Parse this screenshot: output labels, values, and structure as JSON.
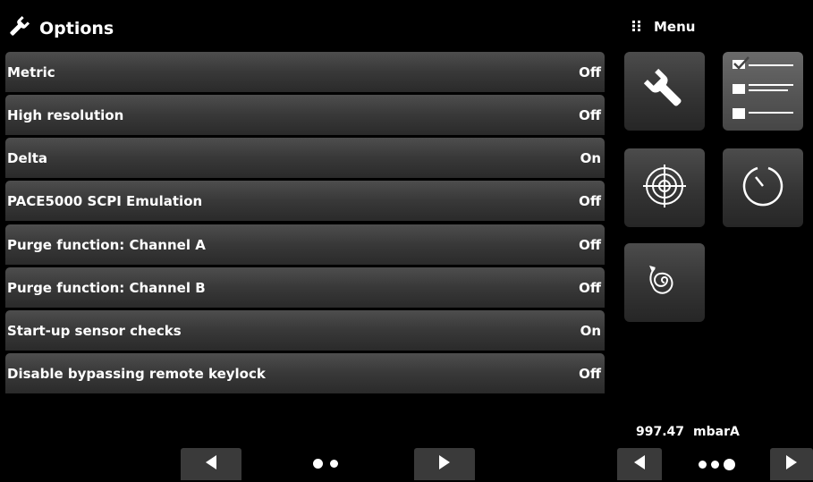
{
  "header": {
    "title": "Options",
    "icon": "wrench-icon"
  },
  "menu": {
    "label": "Menu",
    "icon": "grid-dots-icon"
  },
  "options": [
    {
      "label": "Metric",
      "value": "Off"
    },
    {
      "label": "High resolution",
      "value": "Off"
    },
    {
      "label": "Delta",
      "value": "On"
    },
    {
      "label": "PACE5000 SCPI Emulation",
      "value": "Off"
    },
    {
      "label": "Purge function: Channel A",
      "value": "Off"
    },
    {
      "label": "Purge function: Channel B",
      "value": "Off"
    },
    {
      "label": "Start-up sensor checks",
      "value": "On"
    },
    {
      "label": "Disable bypassing remote keylock",
      "value": "Off"
    }
  ],
  "tiles": [
    {
      "icon": "wrench-icon",
      "active": false
    },
    {
      "icon": "checklist-icon",
      "active": true
    },
    {
      "icon": "target-icon",
      "active": false
    },
    {
      "icon": "timer-icon",
      "active": false
    },
    {
      "icon": "spiral-arrow-icon",
      "active": false
    }
  ],
  "reading": {
    "value": "997.47",
    "unit": "mbarA"
  },
  "list_pager": {
    "pages": 2
  },
  "menu_pager": {
    "pages": 3
  }
}
